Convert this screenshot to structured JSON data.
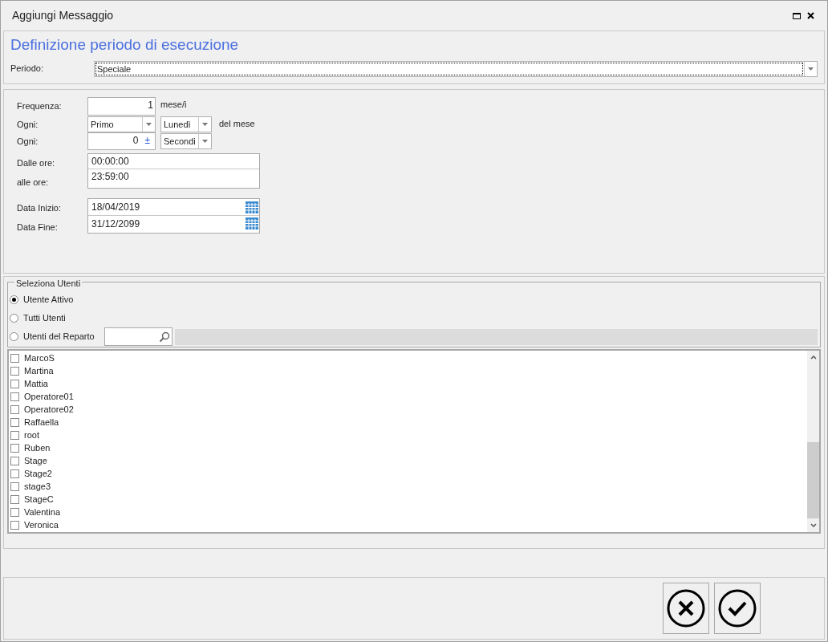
{
  "window": {
    "title": "Aggiungi Messaggio"
  },
  "header": {
    "title": "Definizione periodo di esecuzione",
    "period_label": "Periodo:",
    "period_value": "Speciale"
  },
  "form": {
    "frequency_label": "Frequenza:",
    "frequency_value": "1",
    "frequency_unit": "mese/i",
    "every_label": "Ogni:",
    "ordinal_value": "Primo",
    "weekday_value": "Lunedì",
    "of_month": "del mese",
    "every2_label": "Ogni:",
    "interval_value": "0",
    "spin_symbol": "±",
    "interval_unit": "Secondi",
    "from_label": "Dalle ore:",
    "from_value": "00:00:00",
    "to_label": "alle ore:",
    "to_value": "23:59:00",
    "start_label": "Data Inizio:",
    "start_value": "18/04/2019",
    "end_label": "Data Fine:",
    "end_value": "31/12/2099"
  },
  "users": {
    "title": "Seleziona Utenti",
    "options": [
      {
        "label": "Utente Attivo",
        "selected": true
      },
      {
        "label": "Tutti Utenti",
        "selected": false
      },
      {
        "label": "Utenti del Reparto",
        "selected": false
      }
    ],
    "list": [
      {
        "label": "MarcoS",
        "checked": false
      },
      {
        "label": "Martina",
        "checked": false
      },
      {
        "label": "Mattia",
        "checked": false
      },
      {
        "label": "Operatore01",
        "checked": false
      },
      {
        "label": "Operatore02",
        "checked": false
      },
      {
        "label": "Raffaella",
        "checked": false
      },
      {
        "label": "root",
        "checked": false
      },
      {
        "label": "Ruben",
        "checked": false
      },
      {
        "label": "Stage",
        "checked": false
      },
      {
        "label": "Stage2",
        "checked": false
      },
      {
        "label": "stage3",
        "checked": false
      },
      {
        "label": "StageC",
        "checked": false
      },
      {
        "label": "Valentina",
        "checked": false
      },
      {
        "label": "Veronica",
        "checked": false
      }
    ]
  }
}
